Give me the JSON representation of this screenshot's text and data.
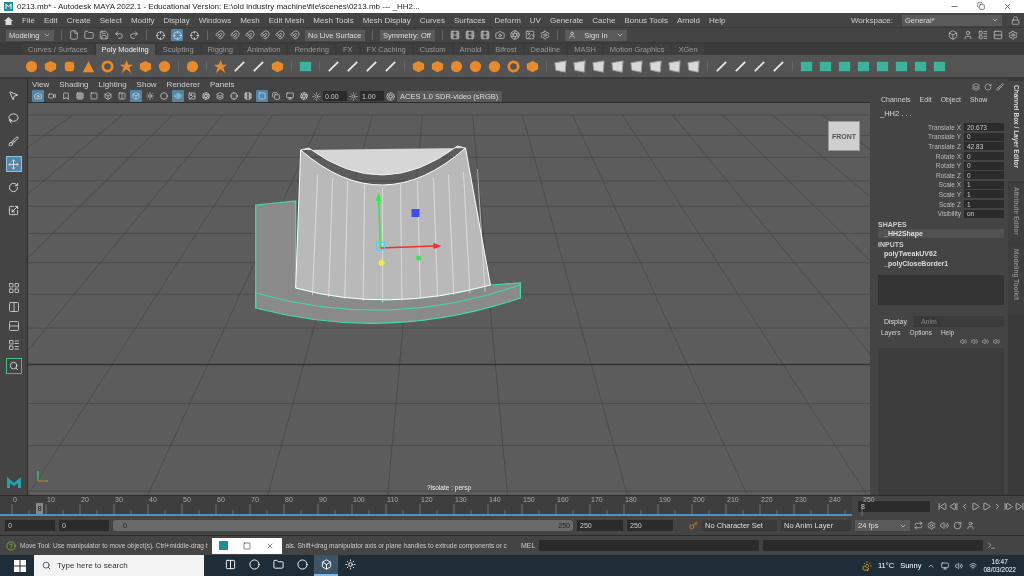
{
  "title_bar": {
    "title": "0213.mb* - Autodesk MAYA 2022.1 - Educational Version: E:\\old industry machine\\file\\scenes\\0213.mb  ---  _HH2..."
  },
  "menu_bar": {
    "items": [
      "File",
      "Edit",
      "Create",
      "Select",
      "Modify",
      "Display",
      "Windows",
      "Mesh",
      "Edit Mesh",
      "Mesh Tools",
      "Mesh Display",
      "Curves",
      "Surfaces",
      "Deform",
      "UV",
      "Generate",
      "Cache",
      "Bonus Tools",
      "Arnold",
      "Help"
    ],
    "workspace_label": "Workspace:",
    "workspace": "General*"
  },
  "status_line": {
    "menu_set": "Modeling",
    "selection_modes": [
      {
        "selected": false
      },
      {
        "selected": true
      },
      {
        "selected": false
      }
    ],
    "live_surface": "No Live Surface",
    "symmetry": "Symmetry: Off",
    "sign_in": "Sign In"
  },
  "shelf": {
    "tabs": [
      {
        "label": "Curves / Surfaces",
        "selected": false
      },
      {
        "label": "Poly Modeling",
        "selected": true
      },
      {
        "label": "Sculpting",
        "selected": false
      },
      {
        "label": "Rigging",
        "selected": false
      },
      {
        "label": "Animation",
        "selected": false
      },
      {
        "label": "Rendering",
        "selected": false
      },
      {
        "label": "FX",
        "selected": false
      },
      {
        "label": "FX Caching",
        "selected": false
      },
      {
        "label": "Custom",
        "selected": false
      },
      {
        "label": "Arnold",
        "selected": false
      },
      {
        "label": "Bifrost",
        "selected": false
      },
      {
        "label": "Deadline",
        "selected": false
      },
      {
        "label": "MASH",
        "selected": false
      },
      {
        "label": "Motion Graphics",
        "selected": false
      },
      {
        "label": "XGen",
        "selected": false
      }
    ]
  },
  "toolbox": {
    "tools": [
      {
        "selected": false
      },
      {
        "selected": false
      },
      {
        "selected": false
      },
      {
        "selected": true
      },
      {
        "selected": false
      },
      {
        "selected": false
      }
    ]
  },
  "viewport": {
    "menus": [
      "View",
      "Shading",
      "Lighting",
      "Show",
      "Renderer",
      "Panels"
    ],
    "toggles": [
      {
        "selected": true
      },
      {
        "selected": false
      },
      {
        "selected": false
      },
      {
        "selected": false
      },
      {
        "selected": false
      },
      {
        "selected": false
      },
      {
        "selected": false
      },
      {
        "selected": true
      },
      {
        "selected": false
      },
      {
        "selected": false
      },
      {
        "selected": true
      },
      {
        "selected": false
      },
      {
        "selected": false
      },
      {
        "selected": false
      },
      {
        "selected": false
      },
      {
        "selected": false
      },
      {
        "selected": true
      },
      {
        "selected": false
      },
      {
        "selected": false
      },
      {
        "selected": false
      }
    ],
    "exposure": "0.00",
    "gamma": "1.00",
    "color_space": "ACES 1.0 SDR-video (sRGB)",
    "view_cube": "FRONT",
    "camera_label": "?isolate : persp"
  },
  "channel_box": {
    "menus": [
      "Channels",
      "Edit",
      "Object",
      "Show"
    ],
    "object": "_HH2 . . .",
    "channels": [
      {
        "name": "Translate X",
        "value": "20.673"
      },
      {
        "name": "Translate Y",
        "value": "0"
      },
      {
        "name": "Translate Z",
        "value": "42.83"
      },
      {
        "name": "Rotate X",
        "value": "0"
      },
      {
        "name": "Rotate Y",
        "value": "0"
      },
      {
        "name": "Rotate Z",
        "value": "0"
      },
      {
        "name": "Scale X",
        "value": "1"
      },
      {
        "name": "Scale Y",
        "value": "1"
      },
      {
        "name": "Scale Z",
        "value": "1"
      },
      {
        "name": "Visibility",
        "value": "on"
      }
    ],
    "shapes_heading": "SHAPES",
    "shapes": [
      {
        "name": "_HH2Shape",
        "selected": true
      }
    ],
    "inputs_heading": "INPUTS",
    "inputs": [
      "polyTweakUV62",
      "_polyCloseBorder1"
    ]
  },
  "layer_editor": {
    "tabs": [
      {
        "label": "Display",
        "selected": true
      },
      {
        "label": "Anim",
        "selected": false
      }
    ],
    "menus": [
      "Layers",
      "Options",
      "Help"
    ]
  },
  "side_tabs": [
    {
      "label": "Channel Box / Layer Editor",
      "selected": true
    },
    {
      "label": "Attribute Editor",
      "selected": false
    },
    {
      "label": "Modeling Toolkit",
      "selected": false
    }
  ],
  "time_slider": {
    "ticks": [
      "0",
      "10",
      "20",
      "30",
      "40",
      "50",
      "60",
      "70",
      "80",
      "90",
      "100",
      "110",
      "120",
      "130",
      "140",
      "150",
      "160",
      "170",
      "180",
      "190",
      "200",
      "210",
      "220",
      "230",
      "240",
      "250"
    ],
    "current_frame": "8",
    "level": 0.032,
    "current_time": "8"
  },
  "range_slider": {
    "start_time": "0",
    "playback_start": "0",
    "range_start": "0",
    "range_end": "250",
    "playback_end": "250",
    "end_time": "250",
    "character_set": "No Character Set",
    "anim_layer": "No Anim Layer",
    "fps": "24 fps"
  },
  "help_line": {
    "text_before": "Move Tool: Use manipulator to move object(s). Ctrl+middle-drag t",
    "text_after": "als. Shift+drag manipulator axis or plane handles to extrude components or c",
    "command_language": "MEL"
  },
  "taskbar": {
    "search_placeholder": "Type here to search",
    "apps": [
      {
        "selected": false
      },
      {
        "selected": false
      },
      {
        "selected": false
      },
      {
        "selected": false
      },
      {
        "selected": true
      },
      {
        "selected": false
      }
    ],
    "temperature": "11°C",
    "weather": "Sunny",
    "time": "16:47",
    "date": "08/03/2022"
  }
}
